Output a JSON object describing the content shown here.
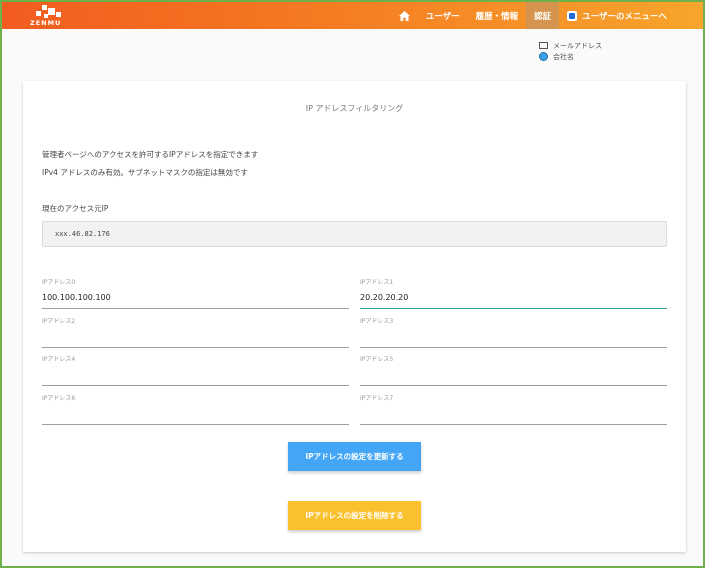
{
  "navbar": {
    "logo_text": "ZENMU",
    "items": [
      {
        "label": "ユーザー"
      },
      {
        "label": "履歴・情報"
      },
      {
        "label": "認証"
      },
      {
        "label": "ユーザーのメニューへ"
      }
    ],
    "gradient_colors": [
      "#f25c1f",
      "#f7a52c"
    ]
  },
  "userinfo": {
    "email_label": "メールアドレス",
    "company_label": "会社名"
  },
  "card": {
    "title": "IP アドレスフィルタリング",
    "description_1": "管理者ページへのアクセスを許可するIPアドレスを指定できます",
    "description_2": "IPv4 アドレスのみ有効。サブネットマスクの指定は無効です",
    "current_label": "現在のアクセス元IP",
    "current_ip": "xxx.46.82.176"
  },
  "ip_fields": [
    {
      "label": "IPアドレス0",
      "value": "100.100.100.100"
    },
    {
      "label": "IPアドレス1",
      "value": "20.20.20.20"
    },
    {
      "label": "IPアドレス2",
      "value": ""
    },
    {
      "label": "IPアドレス3",
      "value": ""
    },
    {
      "label": "IPアドレス4",
      "value": ""
    },
    {
      "label": "IPアドレス5",
      "value": ""
    },
    {
      "label": "IPアドレス6",
      "value": ""
    },
    {
      "label": "IPアドレス7",
      "value": ""
    }
  ],
  "buttons": {
    "update_label": "IPアドレスの設定を更新する",
    "delete_label": "IPアドレスの設定を削除する",
    "update_color": "#42a5f5",
    "delete_color": "#fbc02d"
  },
  "colors": {
    "focus_underline": "#26a69a",
    "window_border": "#6fb04a"
  }
}
